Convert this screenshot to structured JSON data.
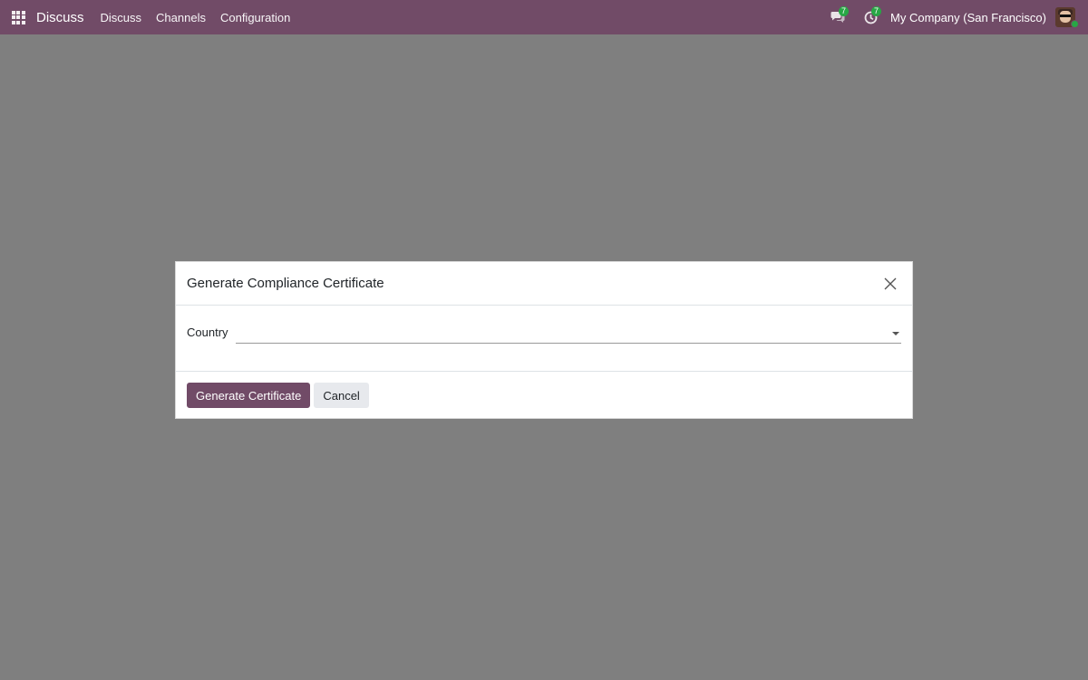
{
  "navbar": {
    "brand": "Discuss",
    "menu": [
      "Discuss",
      "Channels",
      "Configuration"
    ],
    "messages_badge": "7",
    "activities_badge": "7",
    "company": "My Company (San Francisco)",
    "color": "#714b67"
  },
  "icons": {
    "app_menu": "grid-icon",
    "messages": "chat-bubbles-icon",
    "activities": "clock-icon",
    "close": "close-icon",
    "dropdown": "caret-down-icon"
  },
  "dialog": {
    "title": "Generate Compliance Certificate",
    "field_label": "Country",
    "field_value": "",
    "primary_button": "Generate Certificate",
    "secondary_button": "Cancel"
  }
}
